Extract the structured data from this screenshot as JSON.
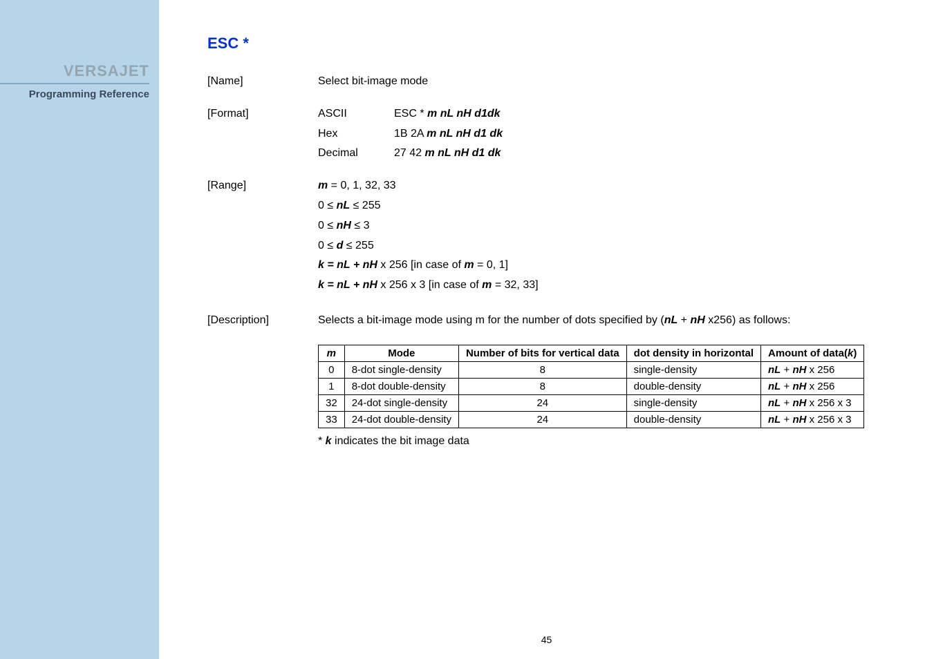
{
  "sidebar": {
    "brand": "VERSAJET",
    "subtitle": "Programming Reference"
  },
  "cmd_title": "ESC *",
  "sections": {
    "name": {
      "label": "[Name]",
      "value": "Select bit-image mode"
    },
    "format": {
      "label": "[Format]",
      "rows": [
        {
          "enc": "ASCII",
          "prefix": "ESC * ",
          "params": "m nL nH d1dk"
        },
        {
          "enc": "Hex",
          "prefix": "1B 2A ",
          "params": "m nL nH d1 dk"
        },
        {
          "enc": "Decimal",
          "prefix": "27 42 ",
          "params": "m nL nH d1 dk"
        }
      ]
    },
    "range": {
      "label": "[Range]",
      "lines_html": [
        "<span class='bold-italic'>m</span> = 0, 1, 32, 33",
        "0 ≤ <span class='bold-italic'>nL</span> ≤ 255",
        "0 ≤ <span class='bold-italic'>nH</span> ≤ 3",
        "0 ≤ <span class='bold-italic'>d</span> ≤ 255",
        "<span class='bold-italic'>k = nL + nH</span> x 256 [in case of <span class='bold-italic'>m</span> = 0, 1]",
        "<span class='bold-italic'>k = nL + nH</span> x 256 x 3 [in case of <span class='bold-italic'>m</span> = 32, 33]"
      ]
    },
    "description": {
      "label": "[Description]",
      "text_html": "Selects a bit-image mode using m for the number of dots specified by (<span class='bold-italic'>nL</span> + <span class='bold-italic'>nH</span> x256) as follows:"
    }
  },
  "table": {
    "headers": {
      "m": "m",
      "mode": "Mode",
      "bits": "Number of bits for vertical data",
      "density": "dot density in horizontal",
      "amount": "Amount of data(k)"
    },
    "rows": [
      {
        "m": "0",
        "mode": "8-dot single-density",
        "bits": "8",
        "density": "single-density",
        "amount_html": "<span class='bold-italic'>nL</span> + <span class='bold-italic'>nH</span> x 256"
      },
      {
        "m": "1",
        "mode": "8-dot double-density",
        "bits": "8",
        "density": "double-density",
        "amount_html": "<span class='bold-italic'>nL</span> + <span class='bold-italic'>nH</span> x 256"
      },
      {
        "m": "32",
        "mode": "24-dot single-density",
        "bits": "24",
        "density": "single-density",
        "amount_html": "<span class='bold-italic'>nL</span> + <span class='bold-italic'>nH</span> x 256 x 3"
      },
      {
        "m": "33",
        "mode": "24-dot double-density",
        "bits": "24",
        "density": "double-density",
        "amount_html": "<span class='bold-italic'>nL</span> + <span class='bold-italic'>nH</span> x 256 x 3"
      }
    ]
  },
  "footnote_html": "* <span class='bold-italic'>k</span> indicates the bit image data",
  "page_number": "45",
  "chart_data": {
    "type": "table",
    "title": "Bit-image mode table for ESC *",
    "columns": [
      "m",
      "Mode",
      "Number of bits for vertical data",
      "dot density in horizontal",
      "Amount of data(k)"
    ],
    "rows": [
      [
        0,
        "8-dot single-density",
        8,
        "single-density",
        "nL + nH x 256"
      ],
      [
        1,
        "8-dot double-density",
        8,
        "double-density",
        "nL + nH x 256"
      ],
      [
        32,
        "24-dot single-density",
        24,
        "single-density",
        "nL + nH x 256 x 3"
      ],
      [
        33,
        "24-dot double-density",
        24,
        "double-density",
        "nL + nH x 256 x 3"
      ]
    ]
  }
}
